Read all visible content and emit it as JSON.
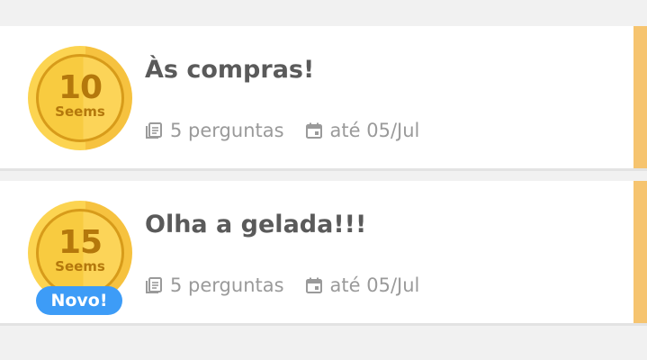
{
  "quizzes": [
    {
      "title": "Às compras!",
      "reward_value": "10",
      "reward_unit": "Seems",
      "questions_label": "5 perguntas",
      "deadline_label": "até 05/Jul",
      "badge": ""
    },
    {
      "title": "Olha a gelada!!!",
      "reward_value": "15",
      "reward_unit": "Seems",
      "questions_label": "5 perguntas",
      "deadline_label": "até 05/Jul",
      "badge": "Novo!"
    }
  ],
  "icons": {
    "questions": "questions-icon",
    "deadline": "calendar-icon"
  },
  "colors": {
    "accent_bar": "#f6c46f",
    "coin_gold": "#fcd451",
    "coin_text": "#b4780c",
    "badge_blue": "#3d9cf7",
    "title_text": "#5a5a5a",
    "meta_text": "#9a9a9a"
  }
}
